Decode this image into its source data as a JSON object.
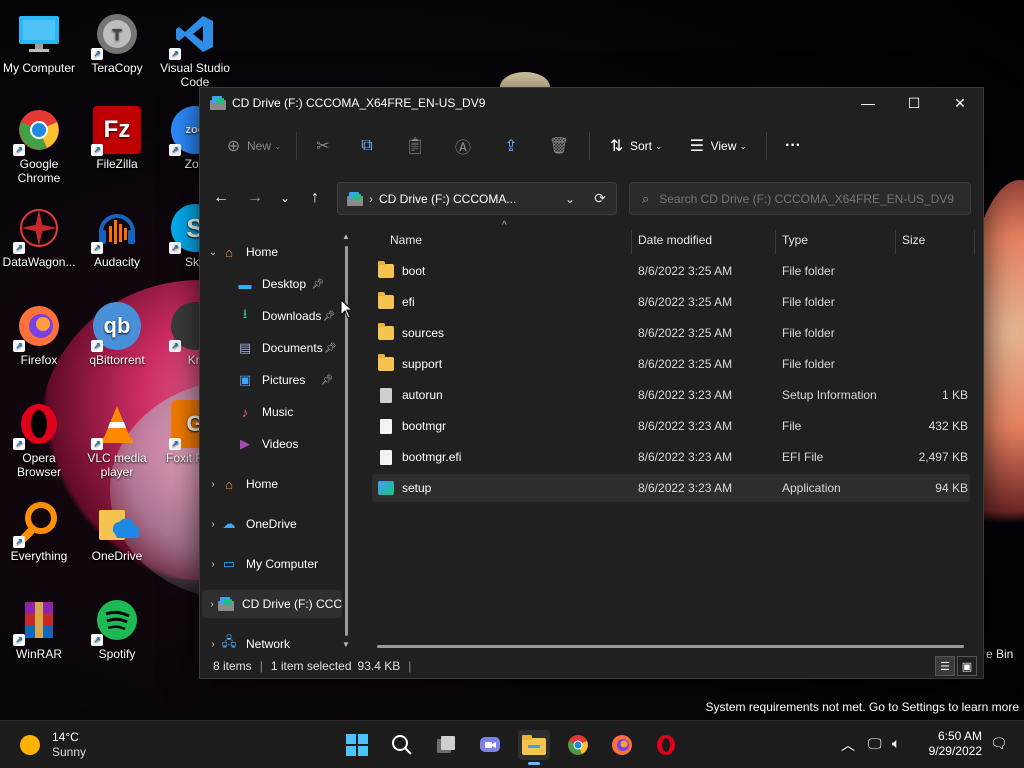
{
  "desktop": {
    "icons": [
      {
        "label": "My Computer"
      },
      {
        "label": "TeraCopy"
      },
      {
        "label": "Visual Studio Code"
      },
      {
        "label": "Google Chrome"
      },
      {
        "label": "FileZilla"
      },
      {
        "label": "Zoo"
      },
      {
        "label": "DataWagon..."
      },
      {
        "label": "Audacity"
      },
      {
        "label": "Sky"
      },
      {
        "label": "Firefox"
      },
      {
        "label": "qBittorrent"
      },
      {
        "label": "Kri"
      },
      {
        "label": "Opera Browser"
      },
      {
        "label": "VLC media player"
      },
      {
        "label": "Foxit Read"
      },
      {
        "label": "Everything"
      },
      {
        "label": "OneDrive"
      },
      {
        "label": "WinRAR"
      },
      {
        "label": "Spotify"
      }
    ],
    "recycle_label": "e Bin",
    "watermark": "System requirements not met. Go to Settings to learn more"
  },
  "window": {
    "title": "CD Drive (F:) CCCOMA_X64FRE_EN-US_DV9",
    "controls": {
      "minimize": "—",
      "maximize": "☐",
      "close": "✕"
    },
    "toolbar": {
      "new_label": "New",
      "sort_label": "Sort",
      "view_label": "View",
      "more_label": "···"
    },
    "address": {
      "crumb": "CD Drive (F:) CCCOMA...",
      "search_placeholder": "Search CD Drive (F:) CCCOMA_X64FRE_EN-US_DV9"
    },
    "nav": {
      "home": "Home",
      "desktop": "Desktop",
      "downloads": "Downloads",
      "documents": "Documents",
      "pictures": "Pictures",
      "music": "Music",
      "videos": "Videos",
      "home2": "Home",
      "onedrive": "OneDrive",
      "mycomputer": "My Computer",
      "cddrive": "CD Drive (F:) CCC",
      "network": "Network"
    },
    "columns": {
      "name": "Name",
      "date": "Date modified",
      "type": "Type",
      "size": "Size"
    },
    "files": [
      {
        "name": "boot",
        "date": "8/6/2022 3:25 AM",
        "type": "File folder",
        "size": "",
        "icon": "folder-icon"
      },
      {
        "name": "efi",
        "date": "8/6/2022 3:25 AM",
        "type": "File folder",
        "size": "",
        "icon": "folder-icon"
      },
      {
        "name": "sources",
        "date": "8/6/2022 3:25 AM",
        "type": "File folder",
        "size": "",
        "icon": "folder-icon"
      },
      {
        "name": "support",
        "date": "8/6/2022 3:25 AM",
        "type": "File folder",
        "size": "",
        "icon": "folder-icon"
      },
      {
        "name": "autorun",
        "date": "8/6/2022 3:23 AM",
        "type": "Setup Information",
        "size": "1 KB",
        "icon": "setup-info-icon"
      },
      {
        "name": "bootmgr",
        "date": "8/6/2022 3:23 AM",
        "type": "File",
        "size": "432 KB",
        "icon": "file-icon"
      },
      {
        "name": "bootmgr.efi",
        "date": "8/6/2022 3:23 AM",
        "type": "EFI File",
        "size": "2,497 KB",
        "icon": "file-icon"
      },
      {
        "name": "setup",
        "date": "8/6/2022 3:23 AM",
        "type": "Application",
        "size": "94 KB",
        "icon": "application-icon"
      }
    ],
    "status": {
      "count": "8 items",
      "selected": "1 item selected",
      "size": "93.4 KB"
    }
  },
  "taskbar": {
    "weather_temp": "14°C",
    "weather_desc": "Sunny",
    "time": "6:50 AM",
    "date": "9/29/2022"
  }
}
